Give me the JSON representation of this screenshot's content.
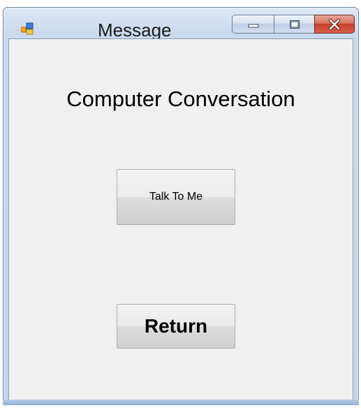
{
  "window": {
    "title": "Message",
    "icon": "app-icon"
  },
  "caption": {
    "minimize_icon": "minimize-icon",
    "maximize_icon": "maximize-icon",
    "close_icon": "close-icon"
  },
  "main": {
    "heading": "Computer Conversation",
    "talk_button_label": "Talk To Me",
    "return_button_label": "Return"
  },
  "colors": {
    "client_background": "#f0f0f0",
    "close_button": "#c43f2a",
    "titlebar": "#c9d9ee"
  }
}
